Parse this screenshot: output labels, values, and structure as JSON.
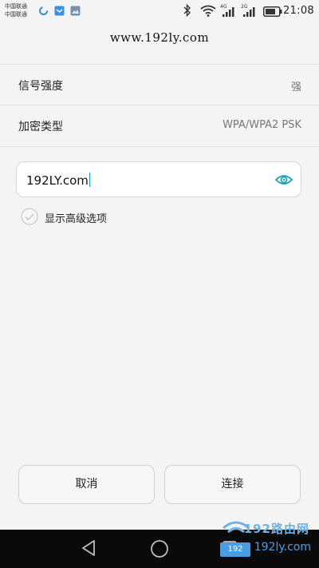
{
  "status_bar": {
    "carrier_1": "中国联通",
    "carrier_2": "中国联通",
    "network_1": "4G",
    "network_2": "2G",
    "time": "21:08",
    "icons": [
      "sync-icon",
      "app-icon",
      "gallery-icon",
      "bluetooth-icon",
      "wifi-icon",
      "signal-icon",
      "battery-icon"
    ]
  },
  "header": {
    "title": "www.192ly.com"
  },
  "info": {
    "signal_label": "信号强度",
    "signal_value": "强",
    "security_label": "加密类型",
    "security_value": "WPA/WPA2 PSK"
  },
  "password": {
    "value": "192LY.com"
  },
  "advanced": {
    "label": "显示高级选项"
  },
  "buttons": {
    "cancel": "取消",
    "connect": "连接"
  },
  "watermark": {
    "top": "192路由网",
    "badge": "192",
    "domain": "192ly.com"
  },
  "colors": {
    "accent": "#1aa0b8",
    "background": "#f4f4f4",
    "nav_bar": "#0a0a0a"
  }
}
